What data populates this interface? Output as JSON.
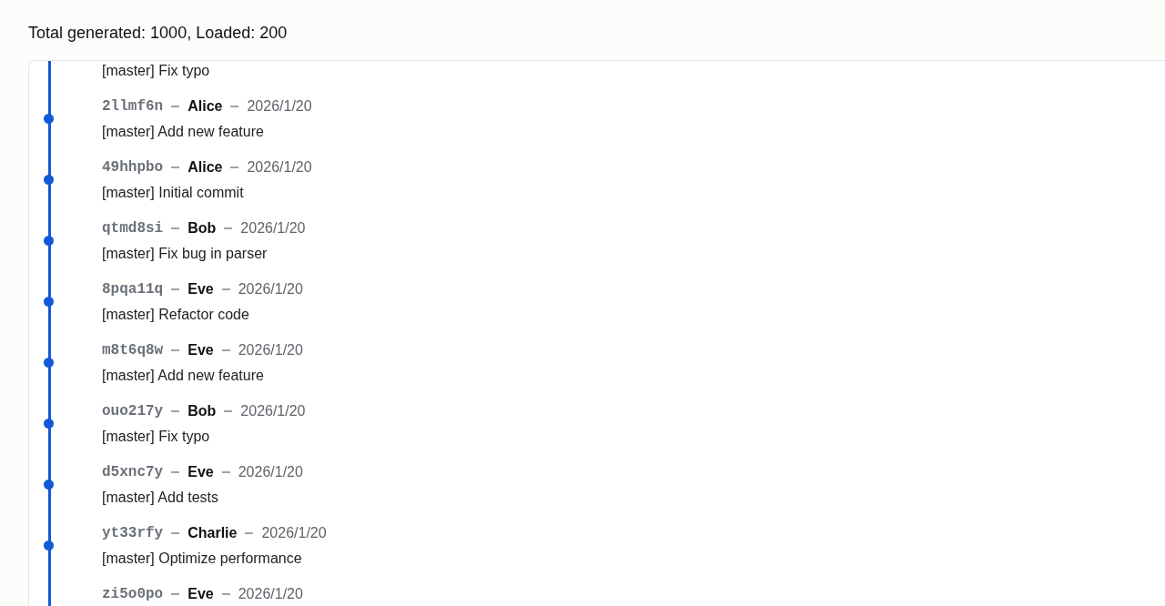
{
  "summary": "Total generated: 1000, Loaded: 200",
  "commits": [
    {
      "message": "[master] Fix typo"
    },
    {
      "hash": "2llmf6n",
      "author": "Alice",
      "date": "2026/1/20",
      "message": "[master] Add new feature"
    },
    {
      "hash": "49hhpbo",
      "author": "Alice",
      "date": "2026/1/20",
      "message": "[master] Initial commit"
    },
    {
      "hash": "qtmd8si",
      "author": "Bob",
      "date": "2026/1/20",
      "message": "[master] Fix bug in parser"
    },
    {
      "hash": "8pqa11q",
      "author": "Eve",
      "date": "2026/1/20",
      "message": "[master] Refactor code"
    },
    {
      "hash": "m8t6q8w",
      "author": "Eve",
      "date": "2026/1/20",
      "message": "[master] Add new feature"
    },
    {
      "hash": "ouo217y",
      "author": "Bob",
      "date": "2026/1/20",
      "message": "[master] Fix typo"
    },
    {
      "hash": "d5xnc7y",
      "author": "Eve",
      "date": "2026/1/20",
      "message": "[master] Add tests"
    },
    {
      "hash": "yt33rfy",
      "author": "Charlie",
      "date": "2026/1/20",
      "message": "[master] Optimize performance"
    },
    {
      "hash": "zi5o0po",
      "author": "Eve",
      "date": "2026/1/20"
    }
  ]
}
